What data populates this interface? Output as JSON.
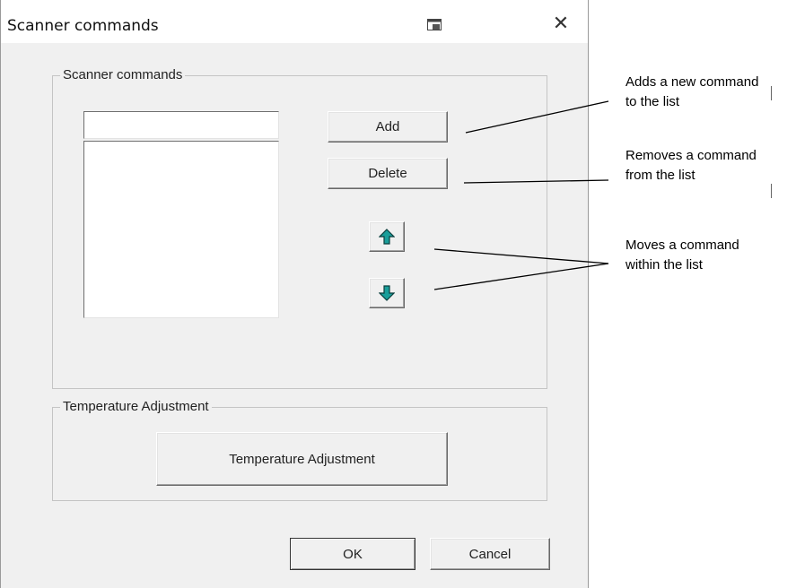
{
  "dialog": {
    "title": "Scanner commands",
    "title_icon": "window-restore-icon",
    "close_glyph": "✕"
  },
  "scanner_group": {
    "title": "Scanner commands",
    "command_input_value": "",
    "command_list": [],
    "add_label": "Add",
    "delete_label": "Delete",
    "move_up_icon": "arrow-up-icon",
    "move_down_icon": "arrow-down-icon"
  },
  "temperature_group": {
    "title": "Temperature Adjustment",
    "button_label": "Temperature Adjustment"
  },
  "footer": {
    "ok_label": "OK",
    "cancel_label": "Cancel"
  },
  "annotations": {
    "add": {
      "line1": "Adds a new command",
      "line2": "to the list"
    },
    "delete": {
      "line1": "Removes a command",
      "line2": "from the list"
    },
    "move": {
      "line1": "Moves a command",
      "line2": "within the list"
    }
  },
  "colors": {
    "dialog_bg": "#f0f0f0",
    "arrow_fill": "#1a9e9a",
    "arrow_dark": "#0b5a58"
  }
}
